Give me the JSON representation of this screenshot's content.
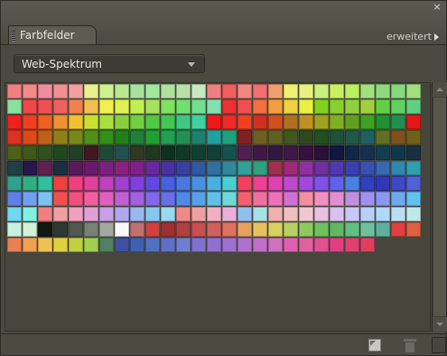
{
  "panel": {
    "tab_label": "Farbfelder",
    "menu_label": "erweitert",
    "close_glyph": "×"
  },
  "library": {
    "selected": "Web-Spektrum"
  },
  "icons": {
    "close": "close-icon",
    "menu_arrow": "chevron-right-icon",
    "dropdown": "chevron-down-icon",
    "new_swatch": "new-swatch-icon",
    "delete": "trash-icon",
    "resize": "resize-icon",
    "grip": "grip-icon"
  },
  "swatches": [
    "#f08080",
    "#f48888",
    "#f08ca0",
    "#f09090",
    "#f0a0a0",
    "#e8f090",
    "#d0f090",
    "#b8e890",
    "#a8e0a0",
    "#a0e8a0",
    "#b0e0a0",
    "#b8e0a8",
    "#c8e8c0",
    "#f08080",
    "#f06060",
    "#f08880",
    "#f07070",
    "#f0a070",
    "#f0f070",
    "#e8f080",
    "#c8f080",
    "#c8f060",
    "#b8f060",
    "#a0e080",
    "#90d880",
    "#88d880",
    "#a0e080",
    "#88e0a0",
    "#f04848",
    "#f05050",
    "#f06060",
    "#f08050",
    "#f0c050",
    "#f0f050",
    "#e0f050",
    "#c0f050",
    "#a8e060",
    "#80e060",
    "#70e070",
    "#70e090",
    "#80e0b0",
    "#f03030",
    "#f05050",
    "#f07040",
    "#f0a040",
    "#f0d040",
    "#e8f040",
    "#80d020",
    "#88d030",
    "#90d040",
    "#a0d040",
    "#60d040",
    "#60d060",
    "#60d080",
    "#f02020",
    "#f04020",
    "#f06020",
    "#f09030",
    "#f0c030",
    "#c8e030",
    "#a8e040",
    "#88d040",
    "#70d040",
    "#50c840",
    "#40c850",
    "#40c880",
    "#40d0a0",
    "#f01818",
    "#f02828",
    "#f04020",
    "#d03020",
    "#d05020",
    "#b07020",
    "#c09020",
    "#a0a020",
    "#80b020",
    "#60a020",
    "#40a020",
    "#209030",
    "#209050",
    "#e01818",
    "#e03020",
    "#e04818",
    "#c06018",
    "#908018",
    "#788818",
    "#509018",
    "#309018",
    "#208018",
    "#208038",
    "#20a030",
    "#20a050",
    "#209050",
    "#208070",
    "#20a0a0",
    "#20a080",
    "#802020",
    "#706020",
    "#606020",
    "#405820",
    "#304820",
    "#205020",
    "#205038",
    "#205848",
    "#206060",
    "#607020",
    "#805020",
    "#706018",
    "#506018",
    "#405818",
    "#305020",
    "#204820",
    "#204028",
    "#401820",
    "#204838",
    "#205050",
    "#303820",
    "#203820",
    "#103020",
    "#103828",
    "#104030",
    "#104038",
    "#185050",
    "#502050",
    "#401848",
    "#301840",
    "#401848",
    "#381040",
    "#281038",
    "#101840",
    "#102848",
    "#183050",
    "#104050",
    "#103848",
    "#183040",
    "#204048",
    "#281848",
    "#602050",
    "#183040",
    "#5a1a5a",
    "#6a1a6a",
    "#7a2080",
    "#8a2080",
    "#802088",
    "#6828a0",
    "#4830a0",
    "#3840a0",
    "#3058a0",
    "#3070a0",
    "#308898",
    "#30a098",
    "#30a080",
    "#a03050",
    "#a02878",
    "#9030a0",
    "#7030a0",
    "#5038b0",
    "#3840b0",
    "#3850b0",
    "#3868b0",
    "#3088b0",
    "#30a0b0",
    "#30a090",
    "#30b080",
    "#30c0a0",
    "#f04040",
    "#f04080",
    "#e040a0",
    "#c040c0",
    "#a040d0",
    "#8040e0",
    "#6048e0",
    "#4860e0",
    "#4878e0",
    "#4890e0",
    "#48b0e0",
    "#48d0d0",
    "#f04060",
    "#f04090",
    "#e040b0",
    "#c048d0",
    "#a048e0",
    "#8050e8",
    "#6060e8",
    "#4880e8",
    "#3040c0",
    "#3038b8",
    "#4048c8",
    "#5060d8",
    "#6080e8",
    "#70a0f0",
    "#80c0f0",
    "#f05050",
    "#f05080",
    "#f060a0",
    "#e060c0",
    "#c060d0",
    "#a060e0",
    "#8068e8",
    "#6870e8",
    "#5088e8",
    "#58a0e8",
    "#60c0e8",
    "#70d8d8",
    "#f06070",
    "#f070a0",
    "#f070b8",
    "#d070d0",
    "#f090a0",
    "#f090c0",
    "#e090d0",
    "#c090e0",
    "#a090f0",
    "#8898f0",
    "#70a8f0",
    "#60c0f0",
    "#70d8f0",
    "#80f0e0",
    "#f08080",
    "#f0a0a0",
    "#f0a0c0",
    "#e0a0d8",
    "#c8a0e8",
    "#b0a8f0",
    "#98b8f0",
    "#88c8f0",
    "#98d8f0",
    "#f08888",
    "#f0a0a0",
    "#f0b0c0",
    "#e8b0d8",
    "#90c0f0",
    "#a8e0e8",
    "#f0b0b0",
    "#f0c0c0",
    "#f0c8d0",
    "#e8c0e0",
    "#d8c0f0",
    "#c8c8f8",
    "#b8d0f8",
    "#b0d8f8",
    "#b8e0f0",
    "#c0e8e8",
    "#c8f0e0",
    "#d0f0d8",
    "#101810",
    "#303830",
    "#505850",
    "#788078",
    "#a0a8a0",
    "#f8f8f8",
    "#c07070",
    "#d04040",
    "#a03030",
    "#b04040",
    "#c85050",
    "#d06060",
    "#e07060",
    "#e8a060",
    "#e8c060",
    "#d8d060",
    "#b8d060",
    "#90c860",
    "#70c060",
    "#60b860",
    "#60c080",
    "#70c0a0",
    "#60b0a0",
    "#e04040",
    "#e06040",
    "#e88050",
    "#f0a050",
    "#f0c050",
    "#e0d040",
    "#c0d040",
    "#a0d050",
    "#508060",
    "#4050a0",
    "#4060b0",
    "#5070c0",
    "#6070c8",
    "#7080d0",
    "#8070d0",
    "#9070d0",
    "#a070d0",
    "#b070d0",
    "#c070c8",
    "#d070c0",
    "#e060b0",
    "#e060a0",
    "#e05090",
    "#e04080",
    "#e04070",
    "#e04060"
  ]
}
